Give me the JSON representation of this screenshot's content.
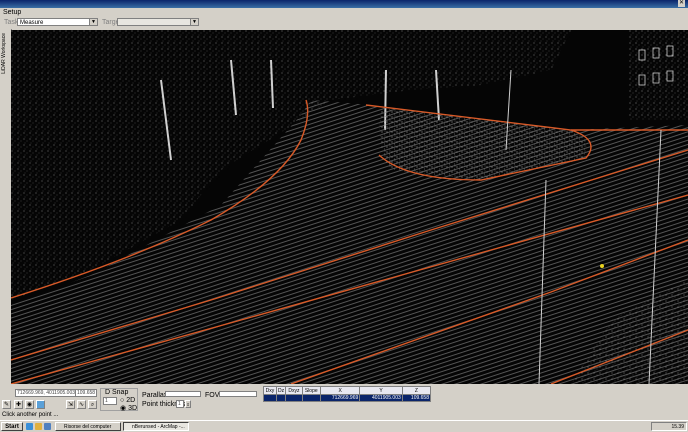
{
  "menu": {
    "setup": "Setup"
  },
  "toolbar": {
    "task_label": "Task:",
    "task_value": "Measure",
    "target_label": "Target:",
    "target_value": ""
  },
  "side_tab": {
    "label": "LiDAR Workspace"
  },
  "bottom": {
    "xy_field": "712669.969, 4011905.003",
    "z_field": "109.658",
    "dsnap_label": "D Snap",
    "dsnap_value": "1",
    "opt_2d": "2D",
    "opt_3d": "3D",
    "parallax_label": "Parallax:",
    "fov_label": "FOV:",
    "thickness_label": "Point thickness:",
    "thickness_value": "1",
    "table": {
      "headers": [
        "Dxy",
        "Dz",
        "Dxyz",
        "Slope",
        "X",
        "Y",
        "Z"
      ],
      "row": [
        "",
        "",
        "",
        "",
        "712669.969",
        "4011905.003",
        "109.658"
      ]
    }
  },
  "status": {
    "text": "Click another point ..."
  },
  "taskbar": {
    "start": "Start",
    "task1": "Risorse del computer",
    "task2": "nBerunsed - ArcMap -...",
    "clock": "15.39"
  },
  "colors": {
    "curb": "#d85a28",
    "points": "#c8c8c8",
    "highlight": "#0a246a"
  }
}
